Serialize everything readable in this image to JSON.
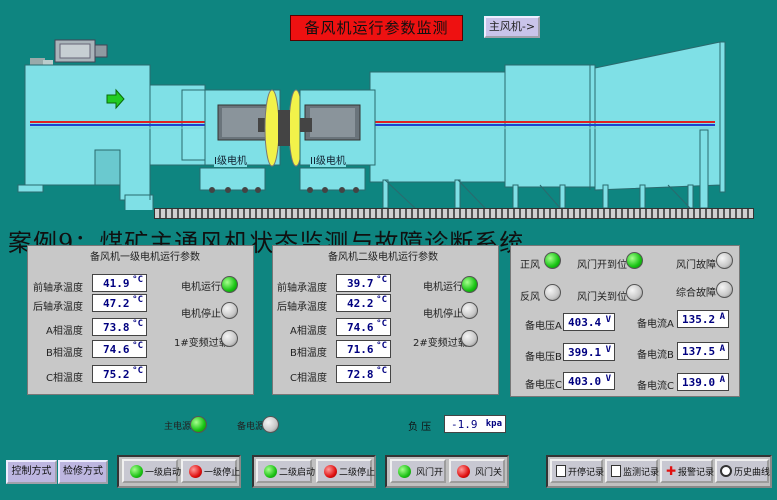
{
  "header": {
    "title": "备风机运行参数监测",
    "switch_button": "主风机->"
  },
  "fan": {
    "motor1_label": "I级电机",
    "motor2_label": "II级电机"
  },
  "overlay_title": "案例9：煤矿主通风机状态监测与故障诊断系统",
  "panel1": {
    "title": "备风机一级电机运行参数",
    "unit": "°C",
    "rows": [
      {
        "label": "前轴承温度",
        "value": "41.9"
      },
      {
        "label": "后轴承温度",
        "value": "47.2"
      },
      {
        "label": "A相温度",
        "value": "73.8"
      },
      {
        "label": "B相温度",
        "value": "74.6"
      },
      {
        "label": "C相温度",
        "value": "75.2"
      }
    ],
    "status": [
      {
        "label": "电机运行",
        "state": "green"
      },
      {
        "label": "电机停止",
        "state": "gray"
      },
      {
        "label": "1#变频过载",
        "state": "gray"
      }
    ]
  },
  "panel2": {
    "title": "备风机二级电机运行参数",
    "unit": "°C",
    "rows": [
      {
        "label": "前轴承温度",
        "value": "39.7"
      },
      {
        "label": "后轴承温度",
        "value": "42.2"
      },
      {
        "label": "A相温度",
        "value": "74.6"
      },
      {
        "label": "B相温度",
        "value": "71.6"
      },
      {
        "label": "C相温度",
        "value": "72.8"
      }
    ],
    "status": [
      {
        "label": "电机运行",
        "state": "green"
      },
      {
        "label": "电机停止",
        "state": "gray"
      },
      {
        "label": "2#变频过载",
        "state": "gray"
      }
    ]
  },
  "panel3": {
    "indicators": [
      {
        "label": "正风",
        "state": "green"
      },
      {
        "label": "风门开到位",
        "state": "green"
      },
      {
        "label": "风门故障",
        "state": "gray"
      },
      {
        "label": "反风",
        "state": "gray"
      },
      {
        "label": "风门关到位",
        "state": "gray"
      },
      {
        "label": "综合故障",
        "state": "gray"
      }
    ],
    "voltage_unit": "V",
    "current_unit": "A",
    "voltages": [
      {
        "label": "备电压A",
        "value": "403.4"
      },
      {
        "label": "备电压B",
        "value": "399.1"
      },
      {
        "label": "备电压C",
        "value": "403.0"
      }
    ],
    "currents": [
      {
        "label": "备电流A",
        "value": "135.2"
      },
      {
        "label": "备电流B",
        "value": "137.5"
      },
      {
        "label": "备电流C",
        "value": "139.0"
      }
    ]
  },
  "power": {
    "main_label": "主电源",
    "main_state": "green",
    "backup_label": "备电源",
    "backup_state": "gray"
  },
  "pressure": {
    "label": "负 压",
    "value": "-1.9",
    "unit": "kpa"
  },
  "toolbar": {
    "control_mode": "控制方式",
    "maintenance_mode": "检修方式",
    "stage1_start": "一级启动",
    "stage1_stop": "一级停止",
    "stage2_start": "二级启动",
    "stage2_stop": "二级停止",
    "damper_open": "风门开",
    "damper_close": "风门关",
    "run_record": "开停记录",
    "monitor_record": "监测记录",
    "alarm_record": "报警记录",
    "history_curve": "历史曲线"
  },
  "colors": {
    "background": "#0e8580",
    "fan_body": "#7fe0e6",
    "title_bg": "#ee1111",
    "led_on": "#17c313",
    "led_off": "#c8c8c8"
  }
}
